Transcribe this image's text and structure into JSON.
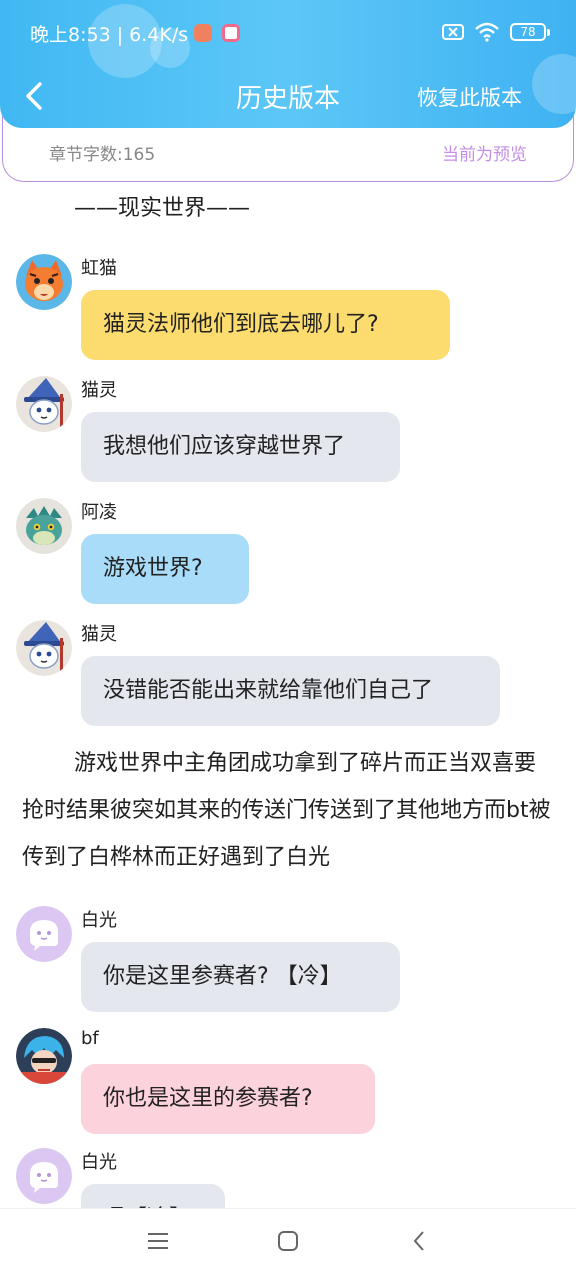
{
  "status_bar": {
    "time": "晚上8:53 | 6.4K/s",
    "battery": "78"
  },
  "header": {
    "title": "历史版本",
    "restore": "恢复此版本",
    "color": "#41b8f3"
  },
  "info": {
    "word_count": "章节字数:165",
    "preview": "当前为预览"
  },
  "content": {
    "scene_title": "——现实世界——",
    "messages": [
      {
        "sender": "虹猫",
        "text": "猫灵法师他们到底去哪儿了?",
        "avatar_icon": "orange-tiger-avatar",
        "bubble_color": "#fcdc6e"
      },
      {
        "sender": "猫灵",
        "text": "我想他们应该穿越世界了",
        "avatar_icon": "wizard-cat-avatar",
        "bubble_color": "#e4e8ee"
      },
      {
        "sender": "阿凌",
        "text": "游戏世界?",
        "avatar_icon": "green-lizard-avatar",
        "bubble_color": "#a9dcf9"
      },
      {
        "sender": "猫灵",
        "text": "没错能否能出来就给靠他们自己了",
        "avatar_icon": "wizard-cat-avatar",
        "bubble_color": "#e4e8ee"
      },
      {
        "sender": "白光",
        "text": "你是这里参赛者? 【冷】",
        "avatar_icon": "purple-ghost-avatar",
        "bubble_color": "#e4e8ee"
      },
      {
        "sender": "bf",
        "text": "你也是这里的参赛者?",
        "avatar_icon": "blue-hair-avatar",
        "bubble_color": "#fcd2dc"
      },
      {
        "sender": "白光",
        "text": "嗯【冷】",
        "avatar_icon": "purple-ghost-avatar",
        "bubble_color": "#e4e8ee"
      }
    ],
    "narration": "游戏世界中主角团成功拿到了碎片而正当双喜要抢时结果彼突如其来的传送门传送到了其他地方而bt被传到了白桦林而正好遇到了白光"
  }
}
